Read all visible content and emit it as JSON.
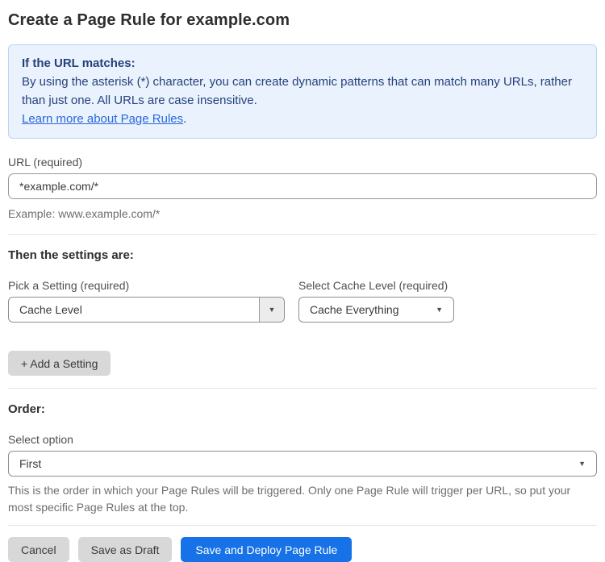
{
  "page": {
    "title": "Create a Page Rule for example.com"
  },
  "info_box": {
    "heading": "If the URL matches:",
    "body": "By using the asterisk (*) character, you can create dynamic patterns that can match many URLs, rather than just one. All URLs are case insensitive.",
    "link_label": "Learn more about Page Rules",
    "link_suffix": "."
  },
  "url_field": {
    "label": "URL (required)",
    "value": "*example.com/*",
    "hint": "Example: www.example.com/*"
  },
  "settings": {
    "heading": "Then the settings are:",
    "setting_label": "Pick a Setting (required)",
    "setting_value": "Cache Level",
    "cache_label": "Select Cache Level (required)",
    "cache_value": "Cache Everything",
    "add_button_label": "+ Add a Setting"
  },
  "order": {
    "heading": "Order:",
    "label": "Select option",
    "value": "First",
    "description": "This is the order in which your Page Rules will be triggered. Only one Page Rule will trigger per URL, so put your most specific Page Rules at the top."
  },
  "actions": {
    "cancel": "Cancel",
    "save_draft": "Save as Draft",
    "save_deploy": "Save and Deploy Page Rule"
  },
  "icons": {
    "dropdown_arrow": "▼"
  },
  "colors": {
    "info_bg": "#e9f2fd",
    "info_border": "#b7d6f4",
    "info_text": "#26427c",
    "link_blue": "#2c68d9",
    "primary_button_blue": "#1672e6",
    "gray_button": "#d8d8d8",
    "input_border": "#979797",
    "divider": "#e4e4e4"
  }
}
